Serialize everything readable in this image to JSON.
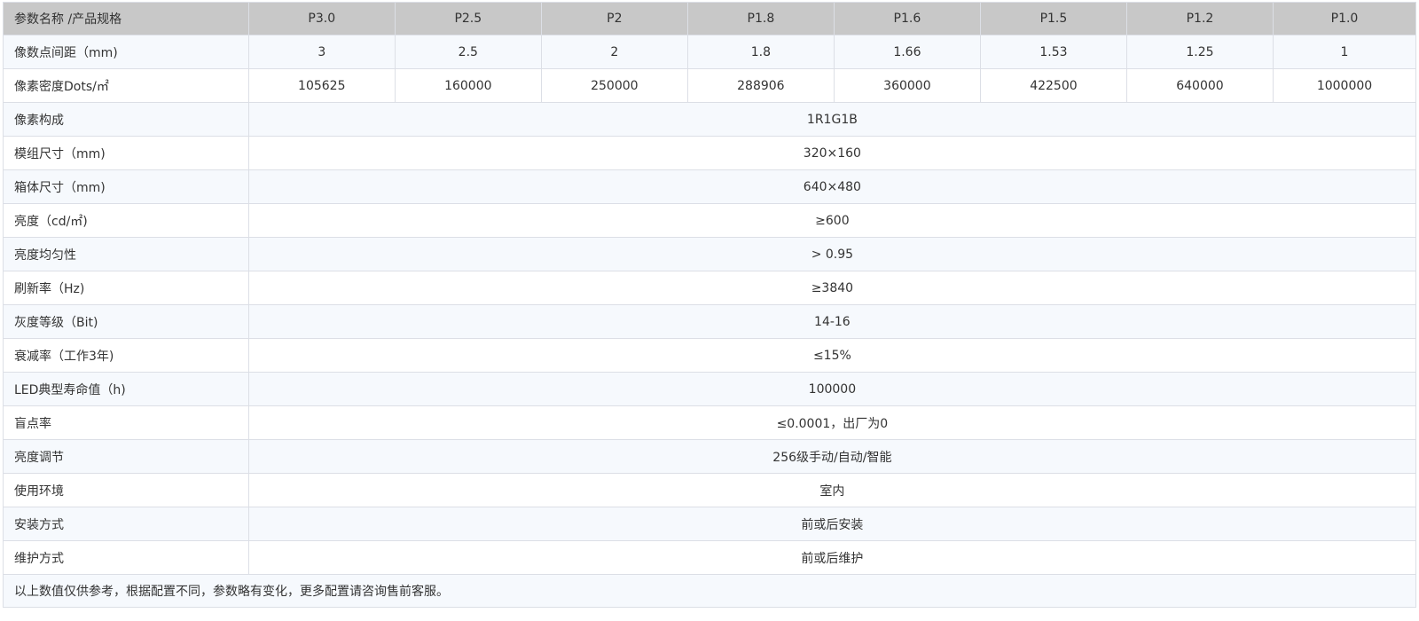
{
  "table": {
    "header": {
      "label": "参数名称 /产品规格",
      "models": [
        "P3.0",
        "P2.5",
        "P2",
        "P1.8",
        "P1.6",
        "P1.5",
        "P1.2",
        "P1.0"
      ]
    },
    "per_model_rows": [
      {
        "label": "像数点间距（mm)",
        "values": [
          "3",
          "2.5",
          "2",
          "1.8",
          "1.66",
          "1.53",
          "1.25",
          "1"
        ]
      },
      {
        "label": "像素密度Dots/㎡",
        "values": [
          "105625",
          "160000",
          "250000",
          "288906",
          "360000",
          "422500",
          "640000",
          "1000000"
        ]
      }
    ],
    "shared_rows": [
      {
        "label": "像素构成",
        "value": "1R1G1B"
      },
      {
        "label": "模组尺寸（mm)",
        "value": "320×160"
      },
      {
        "label": "箱体尺寸（mm)",
        "value": "640×480"
      },
      {
        "label": "亮度（cd/㎡)",
        "value": "≥600"
      },
      {
        "label": "亮度均匀性",
        "value": "> 0.95"
      },
      {
        "label": "刷新率（Hz)",
        "value": "≥3840"
      },
      {
        "label": "灰度等级（Bit)",
        "value": "14-16"
      },
      {
        "label": "衰减率（工作3年)",
        "value": "≤15%"
      },
      {
        "label": "LED典型寿命值（h)",
        "value": "100000"
      },
      {
        "label": "盲点率",
        "value": "≤0.0001，出厂为0"
      },
      {
        "label": "亮度调节",
        "value": "256级手动/自动/智能"
      },
      {
        "label": "使用环境",
        "value": "室内"
      },
      {
        "label": "安装方式",
        "value": "前或后安装"
      },
      {
        "label": "维护方式",
        "value": "前或后维护"
      }
    ],
    "note": "以上数值仅供参考，根据配置不同，参数略有变化，更多配置请咨询售前客服。"
  }
}
